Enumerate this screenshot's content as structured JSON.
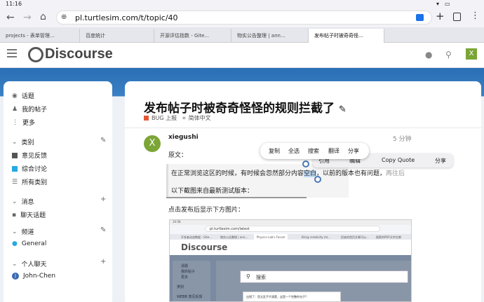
{
  "status": {
    "time": "11:16"
  },
  "browser": {
    "url": "pl.turtlesim.com/t/topic/40",
    "tabs": [
      {
        "label": "projects - 表单管理..."
      },
      {
        "label": "百度统计"
      },
      {
        "label": "开源评估指数 - Gite..."
      },
      {
        "label": "物实公告整理 | ann..."
      },
      {
        "label": "发布帖子时被奇奇怪..."
      }
    ]
  },
  "header": {
    "logo": "Discourse",
    "avatar_letter": "X"
  },
  "sidebar": {
    "top": [
      {
        "label": "话题"
      },
      {
        "label": "我的帖子"
      },
      {
        "label": "更多"
      }
    ],
    "categories_title": "类别",
    "categories": [
      {
        "label": "意见反馈",
        "color": "#555555"
      },
      {
        "label": "综合讨论",
        "color": "#25aae1"
      },
      {
        "label": "所有类别",
        "color": ""
      }
    ],
    "messages_title": "消息",
    "messages": [
      {
        "label": "聊天话题"
      }
    ],
    "channels_title": "频道",
    "channels": [
      {
        "label": "General"
      }
    ],
    "chat_title": "个人聊天",
    "chats": [
      {
        "label": "John-Chen",
        "avatar": "J"
      }
    ]
  },
  "topic": {
    "title": "发布帖子时被奇奇怪怪的规则拦截了",
    "category": "BUG 上报",
    "category_color": "#e45735",
    "tag": "简体中文"
  },
  "post": {
    "username": "xiegushi",
    "avatar_letter": "X",
    "avatar_color": "#7ba536",
    "age": "5 分钟",
    "quote_label": "原文：",
    "quote_text_before": "在正常浏览这区的时候，有时候会忽然部分内容",
    "quote_text_selected": "空白",
    "quote_text_after": "，以前的版本也有问题，",
    "quote_text_hidden": "再往后",
    "line2": "以下截图来自最新测试版本：",
    "line3": "点击发布后显示下方图片："
  },
  "selection_menu": {
    "items": [
      {
        "label": "复制"
      },
      {
        "label": "全选"
      },
      {
        "label": "搜索"
      },
      {
        "label": "翻译"
      },
      {
        "label": "分享"
      }
    ]
  },
  "quote_menu": {
    "items": [
      {
        "label": "引用"
      },
      {
        "label": "编辑"
      },
      {
        "label": "Copy Quote"
      },
      {
        "label": "分享"
      }
    ]
  },
  "screenshot": {
    "url": "pl.turtlesim.com/latest",
    "time": "10:58",
    "tabs": [
      "开发者动态数据 - Gite...",
      "物实公告整理 | ann...",
      "Physics Lab's Forum",
      "Bring creativity int...",
      "民族的首页文章可以...",
      "搜索的PDF文件在哪"
    ],
    "logo": "Discourse",
    "side": [
      "话题",
      "我的帖子",
      "更多"
    ],
    "search_placeholder": "搜索",
    "dialog_text": "出错了：您太乱手不清楚，这是一个完整的句子?",
    "category_label": "类别",
    "category_item": "WEBB 意见反馈"
  }
}
